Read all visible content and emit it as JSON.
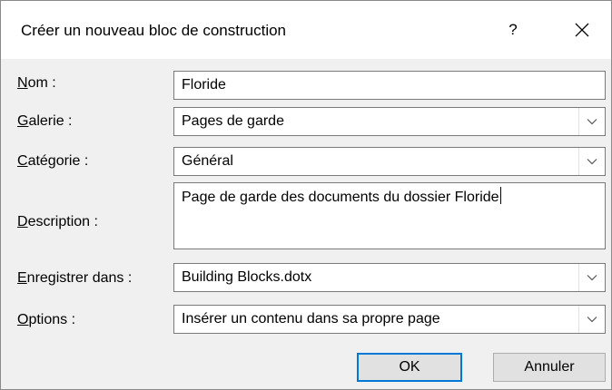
{
  "dialog": {
    "title": "Créer un nouveau bloc de construction",
    "help_label": "?",
    "close_icon": "close-icon"
  },
  "fields": {
    "name": {
      "label_mnemonic": "N",
      "label_rest": "om :",
      "value": "Floride"
    },
    "gallery": {
      "label_mnemonic": "G",
      "label_rest": "alerie :",
      "value": "Pages de garde"
    },
    "category": {
      "label_mnemonic": "C",
      "label_rest": "atégorie :",
      "value": "Général"
    },
    "description": {
      "label_mnemonic": "D",
      "label_rest": "escription :",
      "value": "Page de garde des documents du dossier Floride"
    },
    "save_in": {
      "label_mnemonic": "E",
      "label_rest": "nregistrer dans :",
      "value": "Building Blocks.dotx"
    },
    "options": {
      "label_mnemonic": "O",
      "label_rest": "ptions :",
      "value": "Insérer un contenu dans sa propre page"
    }
  },
  "buttons": {
    "ok_label": "OK",
    "cancel_label": "Annuler"
  },
  "colors": {
    "dialog_bg": "#f0f0f0",
    "titlebar_bg": "#ffffff",
    "focus_border": "#0078d7",
    "field_border": "#7a7a7a"
  }
}
